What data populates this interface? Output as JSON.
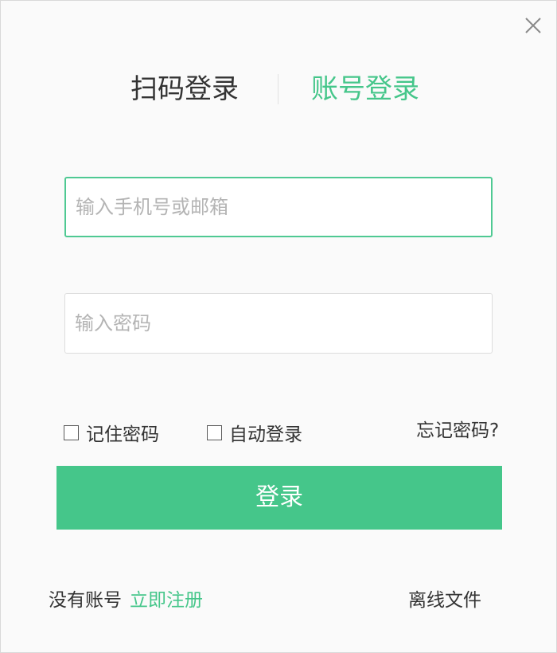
{
  "window": {
    "close_icon": "close-icon"
  },
  "tabs": {
    "qr_login": "扫码登录",
    "account_login": "账号登录",
    "active": "account_login"
  },
  "form": {
    "username_placeholder": "输入手机号或邮箱",
    "username_value": "",
    "password_placeholder": "输入密码",
    "password_value": ""
  },
  "options": {
    "remember_password": "记住密码",
    "remember_checked": false,
    "auto_login": "自动登录",
    "auto_checked": false,
    "forgot_password": "忘记密码?"
  },
  "login_button": "登录",
  "footer": {
    "no_account": "没有账号",
    "register": "立即注册",
    "offline_files": "离线文件"
  },
  "colors": {
    "accent": "#45c68a",
    "text": "#333333",
    "placeholder": "#b4b4b4",
    "background": "#fafafa"
  }
}
